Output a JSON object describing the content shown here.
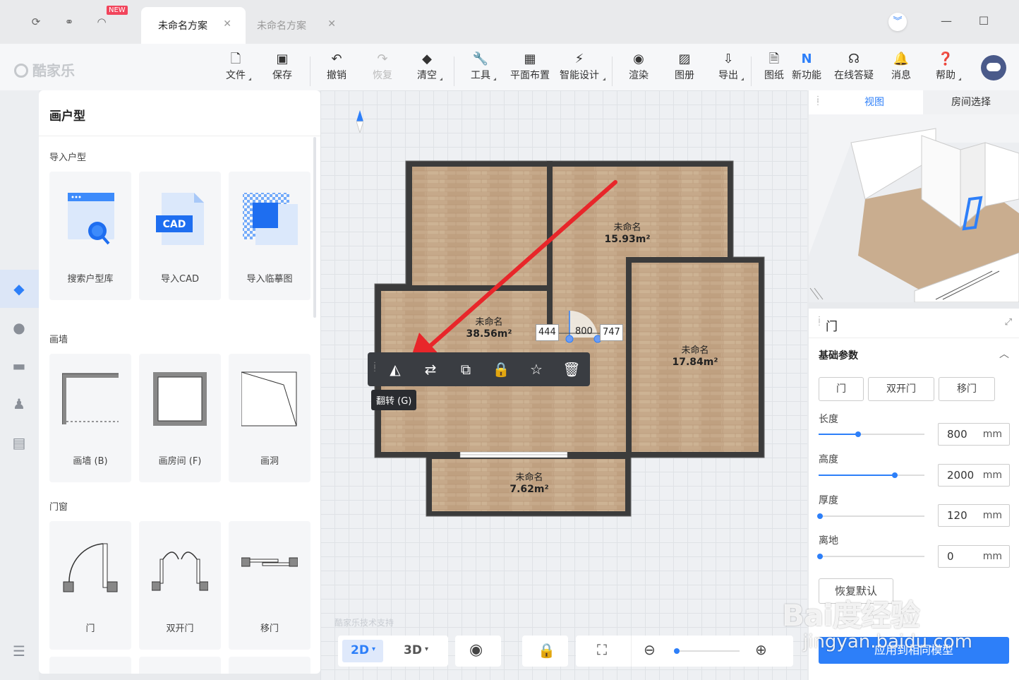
{
  "titlebar": {
    "new_badge": "NEW",
    "tabs": [
      {
        "label": "未命名方案",
        "active": true
      },
      {
        "label": "未命名方案",
        "active": false
      }
    ]
  },
  "toolbar": {
    "logo_text": "酷家乐",
    "items": [
      {
        "label": "文件",
        "icon": "file-icon"
      },
      {
        "label": "保存",
        "icon": "save-icon"
      },
      {
        "label": "撤销",
        "icon": "undo-icon"
      },
      {
        "label": "恢复",
        "icon": "redo-icon"
      },
      {
        "label": "清空",
        "icon": "eraser-icon"
      },
      {
        "label": "工具",
        "icon": "wrench-icon"
      },
      {
        "label": "平面布置",
        "icon": "layout-icon"
      },
      {
        "label": "智能设计",
        "icon": "lightning-icon"
      },
      {
        "label": "渲染",
        "icon": "camera-icon"
      },
      {
        "label": "图册",
        "icon": "album-icon"
      },
      {
        "label": "导出",
        "icon": "export-icon"
      },
      {
        "label": "图纸",
        "icon": "drawing-icon"
      },
      {
        "label": "新功能",
        "icon": "new-feature-icon"
      },
      {
        "label": "在线答疑",
        "icon": "headset-icon"
      },
      {
        "label": "消息",
        "icon": "bell-icon"
      },
      {
        "label": "帮助",
        "icon": "help-icon"
      }
    ]
  },
  "leftpanel": {
    "title": "画户型",
    "sections": [
      {
        "title": "导入户型",
        "cards": [
          "搜索户型库",
          "导入CAD",
          "导入临摹图"
        ]
      },
      {
        "title": "画墙",
        "cards": [
          "画墙 (B)",
          "画房间 (F)",
          "画洞"
        ]
      },
      {
        "title": "门窗",
        "cards": [
          "门",
          "双开门",
          "移门"
        ]
      }
    ],
    "cad_label": "CAD"
  },
  "canvas": {
    "rooms": [
      {
        "name": "未命名",
        "area": "15.93m²"
      },
      {
        "name": "未命名",
        "area": "38.56m²"
      },
      {
        "name": "未命名",
        "area": "17.84m²"
      },
      {
        "name": "未命名",
        "area": "7.62m²"
      }
    ],
    "dims": [
      "444",
      "800",
      "747"
    ],
    "tooltip": "翻转 (G)",
    "watermark": "酷家乐技术支持"
  },
  "bottombar": {
    "mode_2d": "2D",
    "mode_3d": "3D"
  },
  "rightview": {
    "tabs": [
      "视图",
      "房间选择"
    ]
  },
  "props": {
    "title": "门",
    "section": "基础参数",
    "types": [
      "门",
      "双开门",
      "移门"
    ],
    "params": [
      {
        "label": "长度",
        "value": "800",
        "unit": "mm"
      },
      {
        "label": "高度",
        "value": "2000",
        "unit": "mm"
      },
      {
        "label": "厚度",
        "value": "120",
        "unit": "mm"
      },
      {
        "label": "离地",
        "value": "0",
        "unit": "mm"
      }
    ],
    "reset": "恢复默认",
    "apply": "应用到相同模型"
  },
  "watermark": {
    "line1": "Bai度经验",
    "line2": "jingyan.baidu.com"
  },
  "colors": {
    "accent": "#2d7ff9",
    "floor": "#c4a888",
    "wall": "#3a3a3a"
  }
}
